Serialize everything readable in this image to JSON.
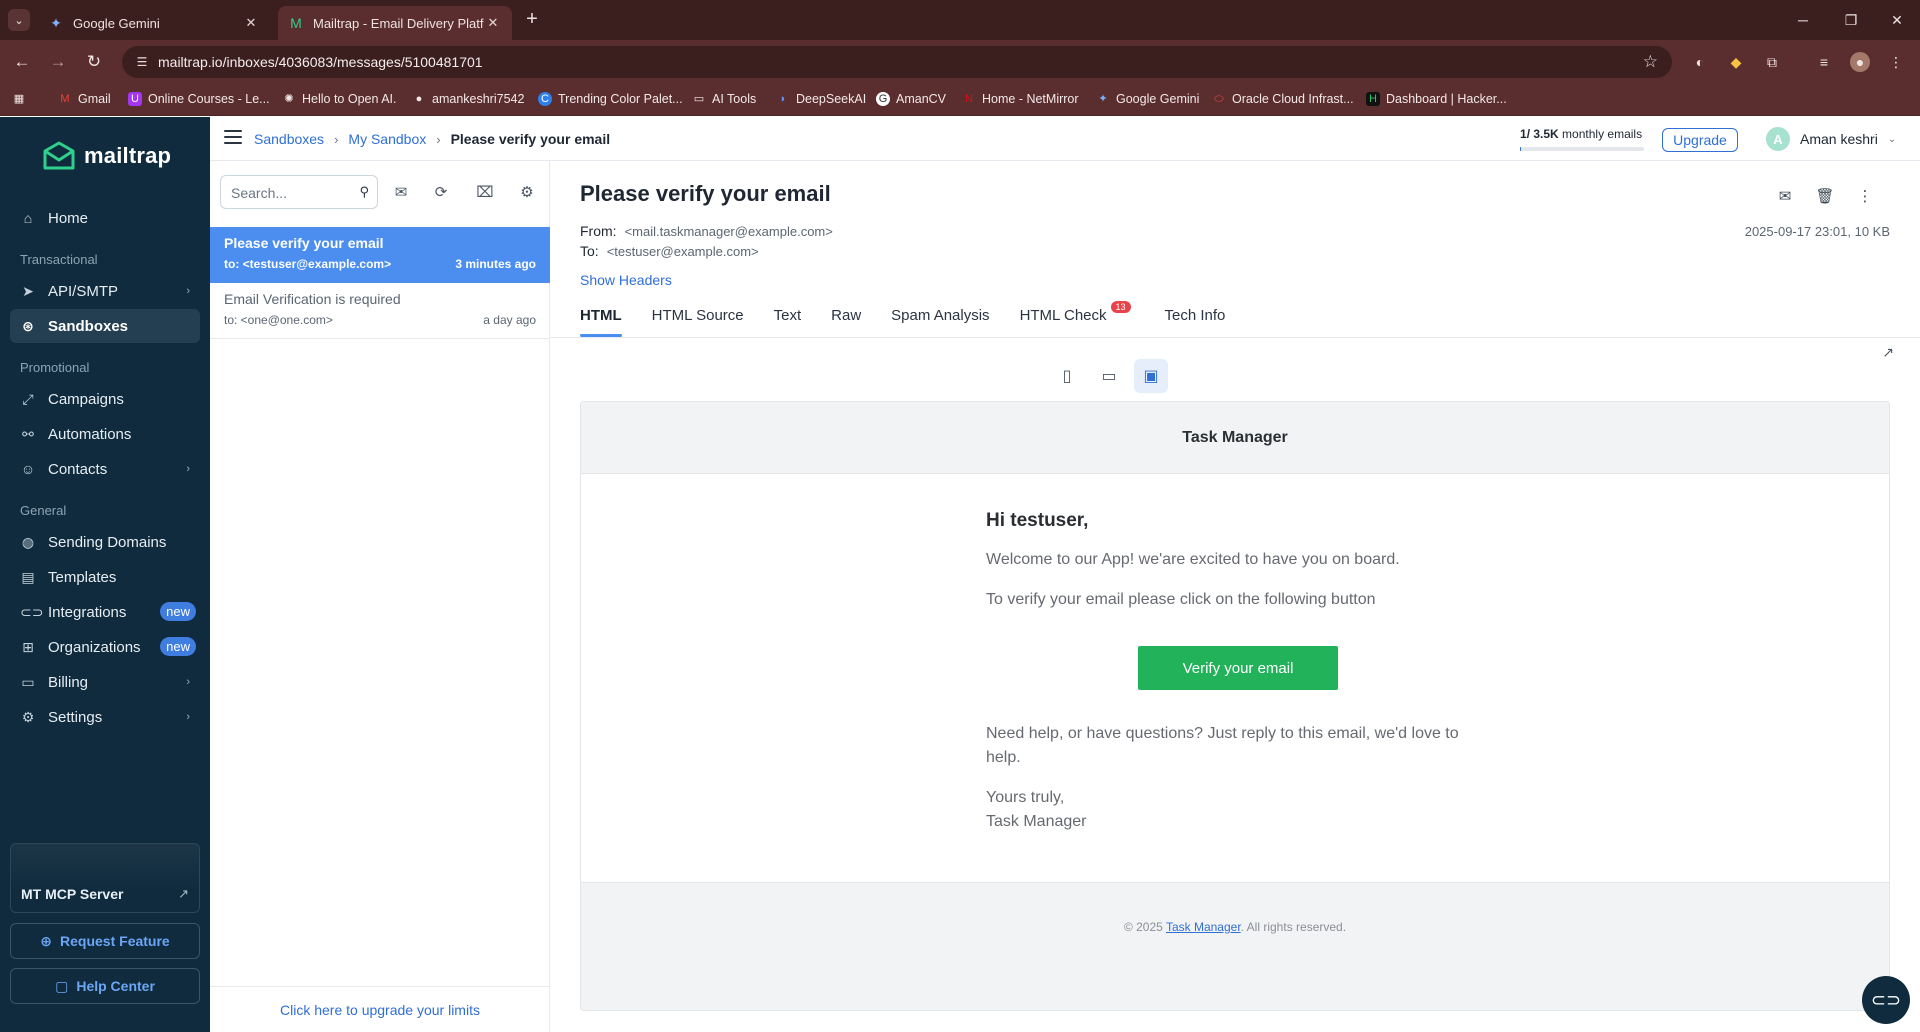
{
  "browser": {
    "tabs": [
      {
        "title": "Google Gemini",
        "icon": "gemini-icon",
        "close": "✕"
      },
      {
        "title": "Mailtrap - Email Delivery Platform",
        "icon": "mailtrap-icon",
        "close": "✕"
      }
    ],
    "url": "mailtrap.io/inboxes/4036083/messages/5100481701",
    "bookmarks": [
      {
        "label": "Gmail",
        "icon": "gmail-icon"
      },
      {
        "label": "Online Courses - Le...",
        "icon": "udemy-icon"
      },
      {
        "label": "Hello to Open AI.",
        "icon": "openai-icon"
      },
      {
        "label": "amankeshri7542",
        "icon": "github-icon"
      },
      {
        "label": "Trending Color Palet...",
        "icon": "coolors-icon"
      },
      {
        "label": "AI Tools",
        "icon": "folder-icon"
      },
      {
        "label": "DeepSeekAI",
        "icon": "deepseek-icon"
      },
      {
        "label": "AmanCV",
        "icon": "cv-icon"
      },
      {
        "label": "Home - NetMirror",
        "icon": "netmirror-icon"
      },
      {
        "label": "Google Gemini",
        "icon": "gemini-icon"
      },
      {
        "label": "Oracle Cloud Infrast...",
        "icon": "oracle-icon"
      },
      {
        "label": "Dashboard | Hacker...",
        "icon": "hackerrank-icon"
      }
    ]
  },
  "sidebar": {
    "brand": "mailtrap",
    "home": "Home",
    "sections": {
      "transactional": "Transactional",
      "promotional": "Promotional",
      "general": "General"
    },
    "items": {
      "api_smtp": "API/SMTP",
      "sandboxes": "Sandboxes",
      "campaigns": "Campaigns",
      "automations": "Automations",
      "contacts": "Contacts",
      "sending_domains": "Sending Domains",
      "templates": "Templates",
      "integrations": "Integrations",
      "organizations": "Organizations",
      "billing": "Billing",
      "settings": "Settings"
    },
    "new_badge": "new",
    "mcp_card": "MT MCP Server",
    "request_feature": "Request Feature",
    "help_center": "Help Center"
  },
  "header": {
    "breadcrumb": [
      "Sandboxes",
      "My Sandbox",
      "Please verify your email"
    ],
    "quota_count": "1",
    "quota_rest": "/ 3.5K",
    "quota_suffix": "monthly emails",
    "upgrade": "Upgrade",
    "user_initial": "A",
    "user_name": "Aman keshri"
  },
  "message_list": {
    "search_placeholder": "Search...",
    "messages": [
      {
        "subject": "Please verify your email",
        "to": "to: <testuser@example.com>",
        "time": "3 minutes ago"
      },
      {
        "subject": "Email Verification is required",
        "to": "to: <one@one.com>",
        "time": "a day ago"
      }
    ],
    "footer_link": "Click here to upgrade your limits"
  },
  "message": {
    "subject": "Please verify your email",
    "from_label": "From:",
    "from": "<mail.taskmanager@example.com>",
    "to_label": "To:",
    "to": "<testuser@example.com>",
    "date_size": "2025-09-17 23:01, 10 KB",
    "show_headers": "Show Headers",
    "tabs": [
      "HTML",
      "HTML Source",
      "Text",
      "Raw",
      "Spam Analysis",
      "HTML Check",
      "Tech Info"
    ],
    "html_check_count": "13"
  },
  "email": {
    "header_title": "Task Manager",
    "greeting": "Hi testuser,",
    "welcome": "Welcome to our App! we'are excited to have you on board.",
    "instruction": "To verify your email please click on the following button",
    "button": "Verify your email",
    "help": "Need help, or have questions? Just reply to this email, we'd love to help.",
    "signoff": "Yours truly,",
    "signature": "Task Manager",
    "footer_prefix": "© 2025 ",
    "footer_link": "Task Manager",
    "footer_suffix": ". All rights reserved."
  },
  "colors": {
    "sidebar_bg": "#0f2b3d",
    "accent": "#2f6fd6",
    "selected_row": "#4b8ef0",
    "verify_button": "#21b25a",
    "browser_frame": "#5a2e2e"
  }
}
